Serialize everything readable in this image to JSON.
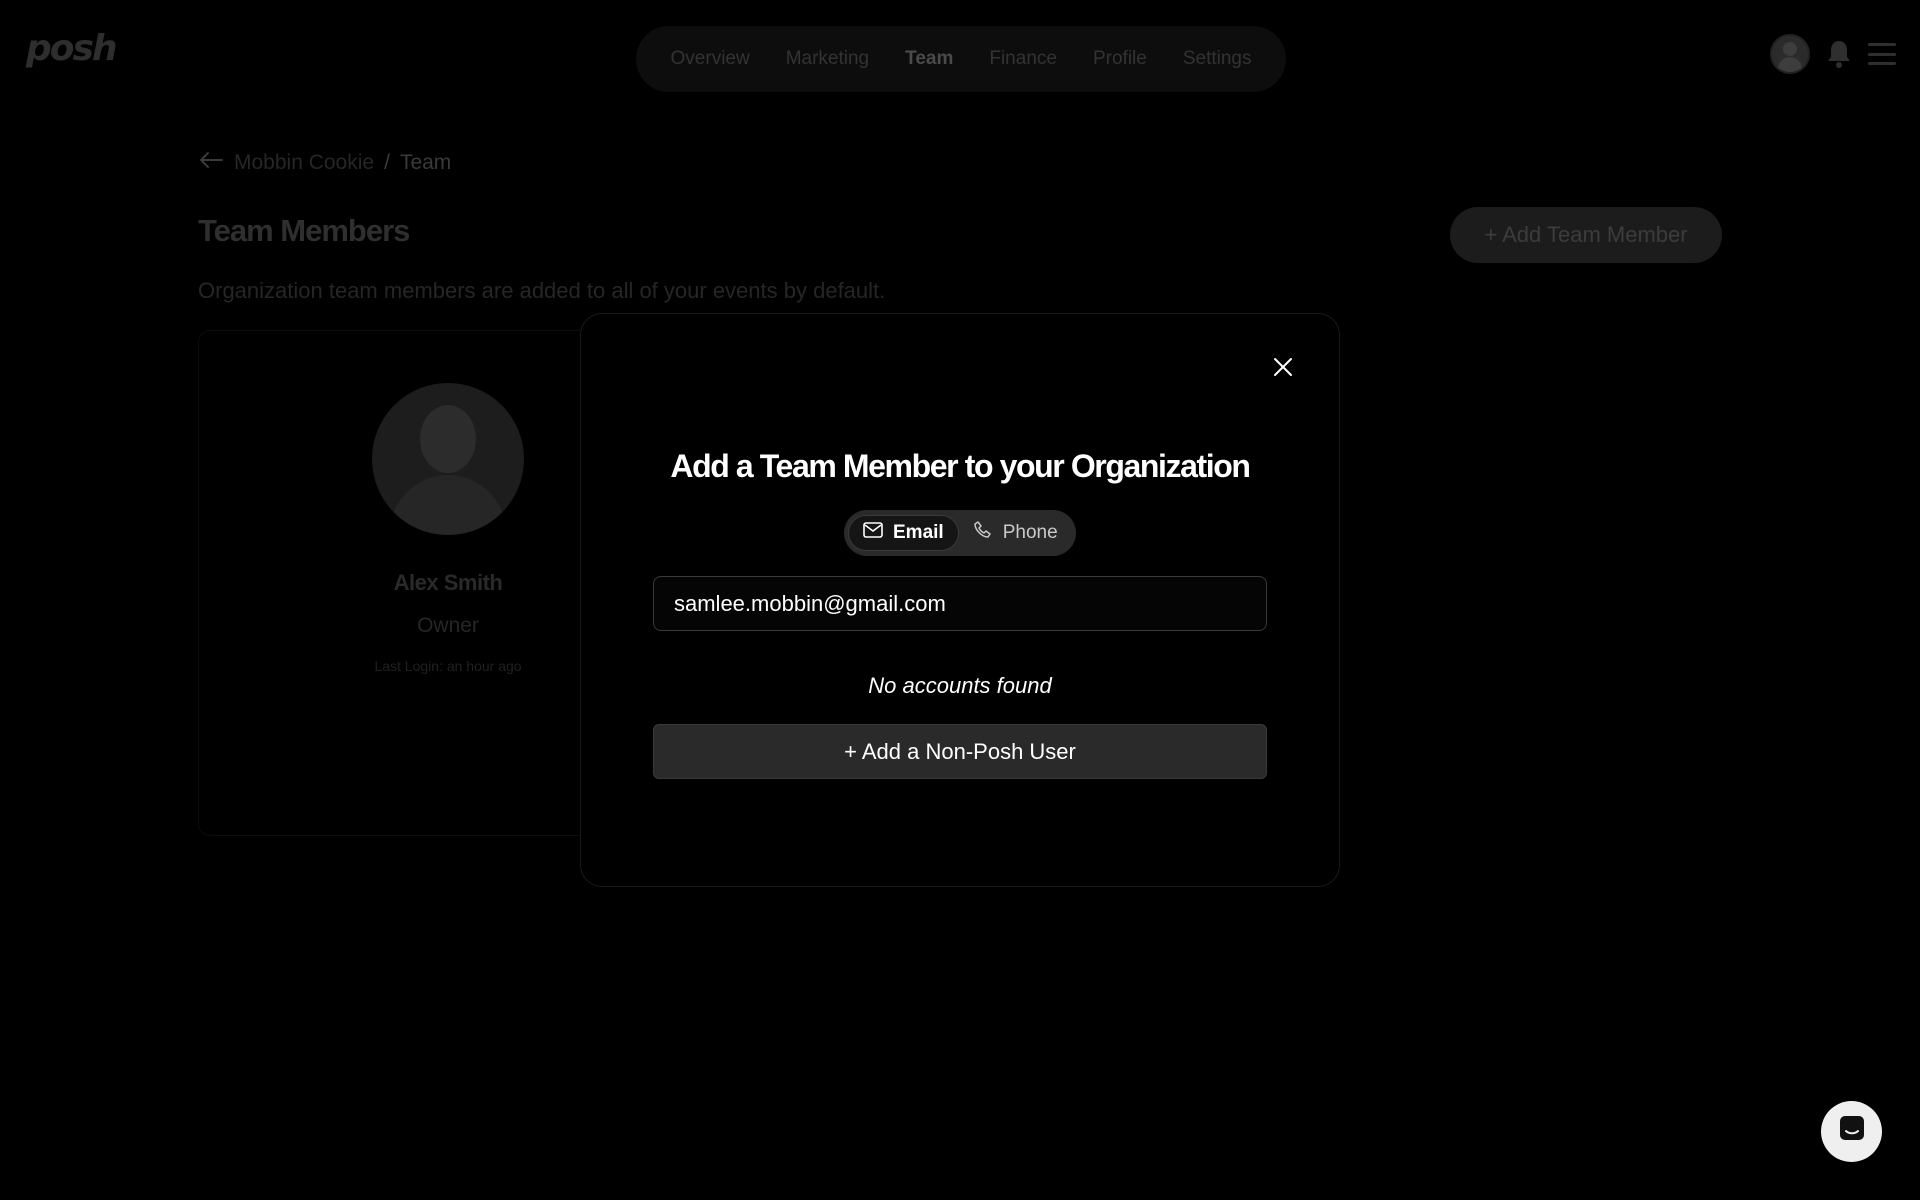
{
  "header": {
    "logo": "posh",
    "nav": [
      {
        "label": "Overview"
      },
      {
        "label": "Marketing"
      },
      {
        "label": "Team",
        "active": true
      },
      {
        "label": "Finance"
      },
      {
        "label": "Profile"
      },
      {
        "label": "Settings"
      }
    ]
  },
  "breadcrumb": {
    "parent": "Mobbin Cookie",
    "separator": "/",
    "current": "Team"
  },
  "page": {
    "title": "Team Members",
    "subtitle": "Organization team members are added to all of your events by default.",
    "add_button": "+ Add Team Member"
  },
  "member": {
    "name": "Alex Smith",
    "role": "Owner",
    "last_login": "Last Login: an hour ago"
  },
  "modal": {
    "title": "Add a Team Member to your Organization",
    "toggle": {
      "email": "Email",
      "phone": "Phone",
      "selected": "Email"
    },
    "input_value": "samlee.mobbin@gmail.com",
    "no_results": "No accounts found",
    "add_non_posh": "+ Add a Non-Posh User"
  },
  "colors": {
    "background": "#000000",
    "modal_border": "#1a1a1a",
    "button_bg": "#2a2a2a",
    "text": "#ffffff"
  },
  "icons": {
    "close": "close-icon",
    "back": "arrow-left-icon",
    "email": "mail-icon",
    "phone": "phone-icon",
    "bell": "bell-icon",
    "menu": "hamburger-menu-icon",
    "chat": "chat-icon"
  }
}
